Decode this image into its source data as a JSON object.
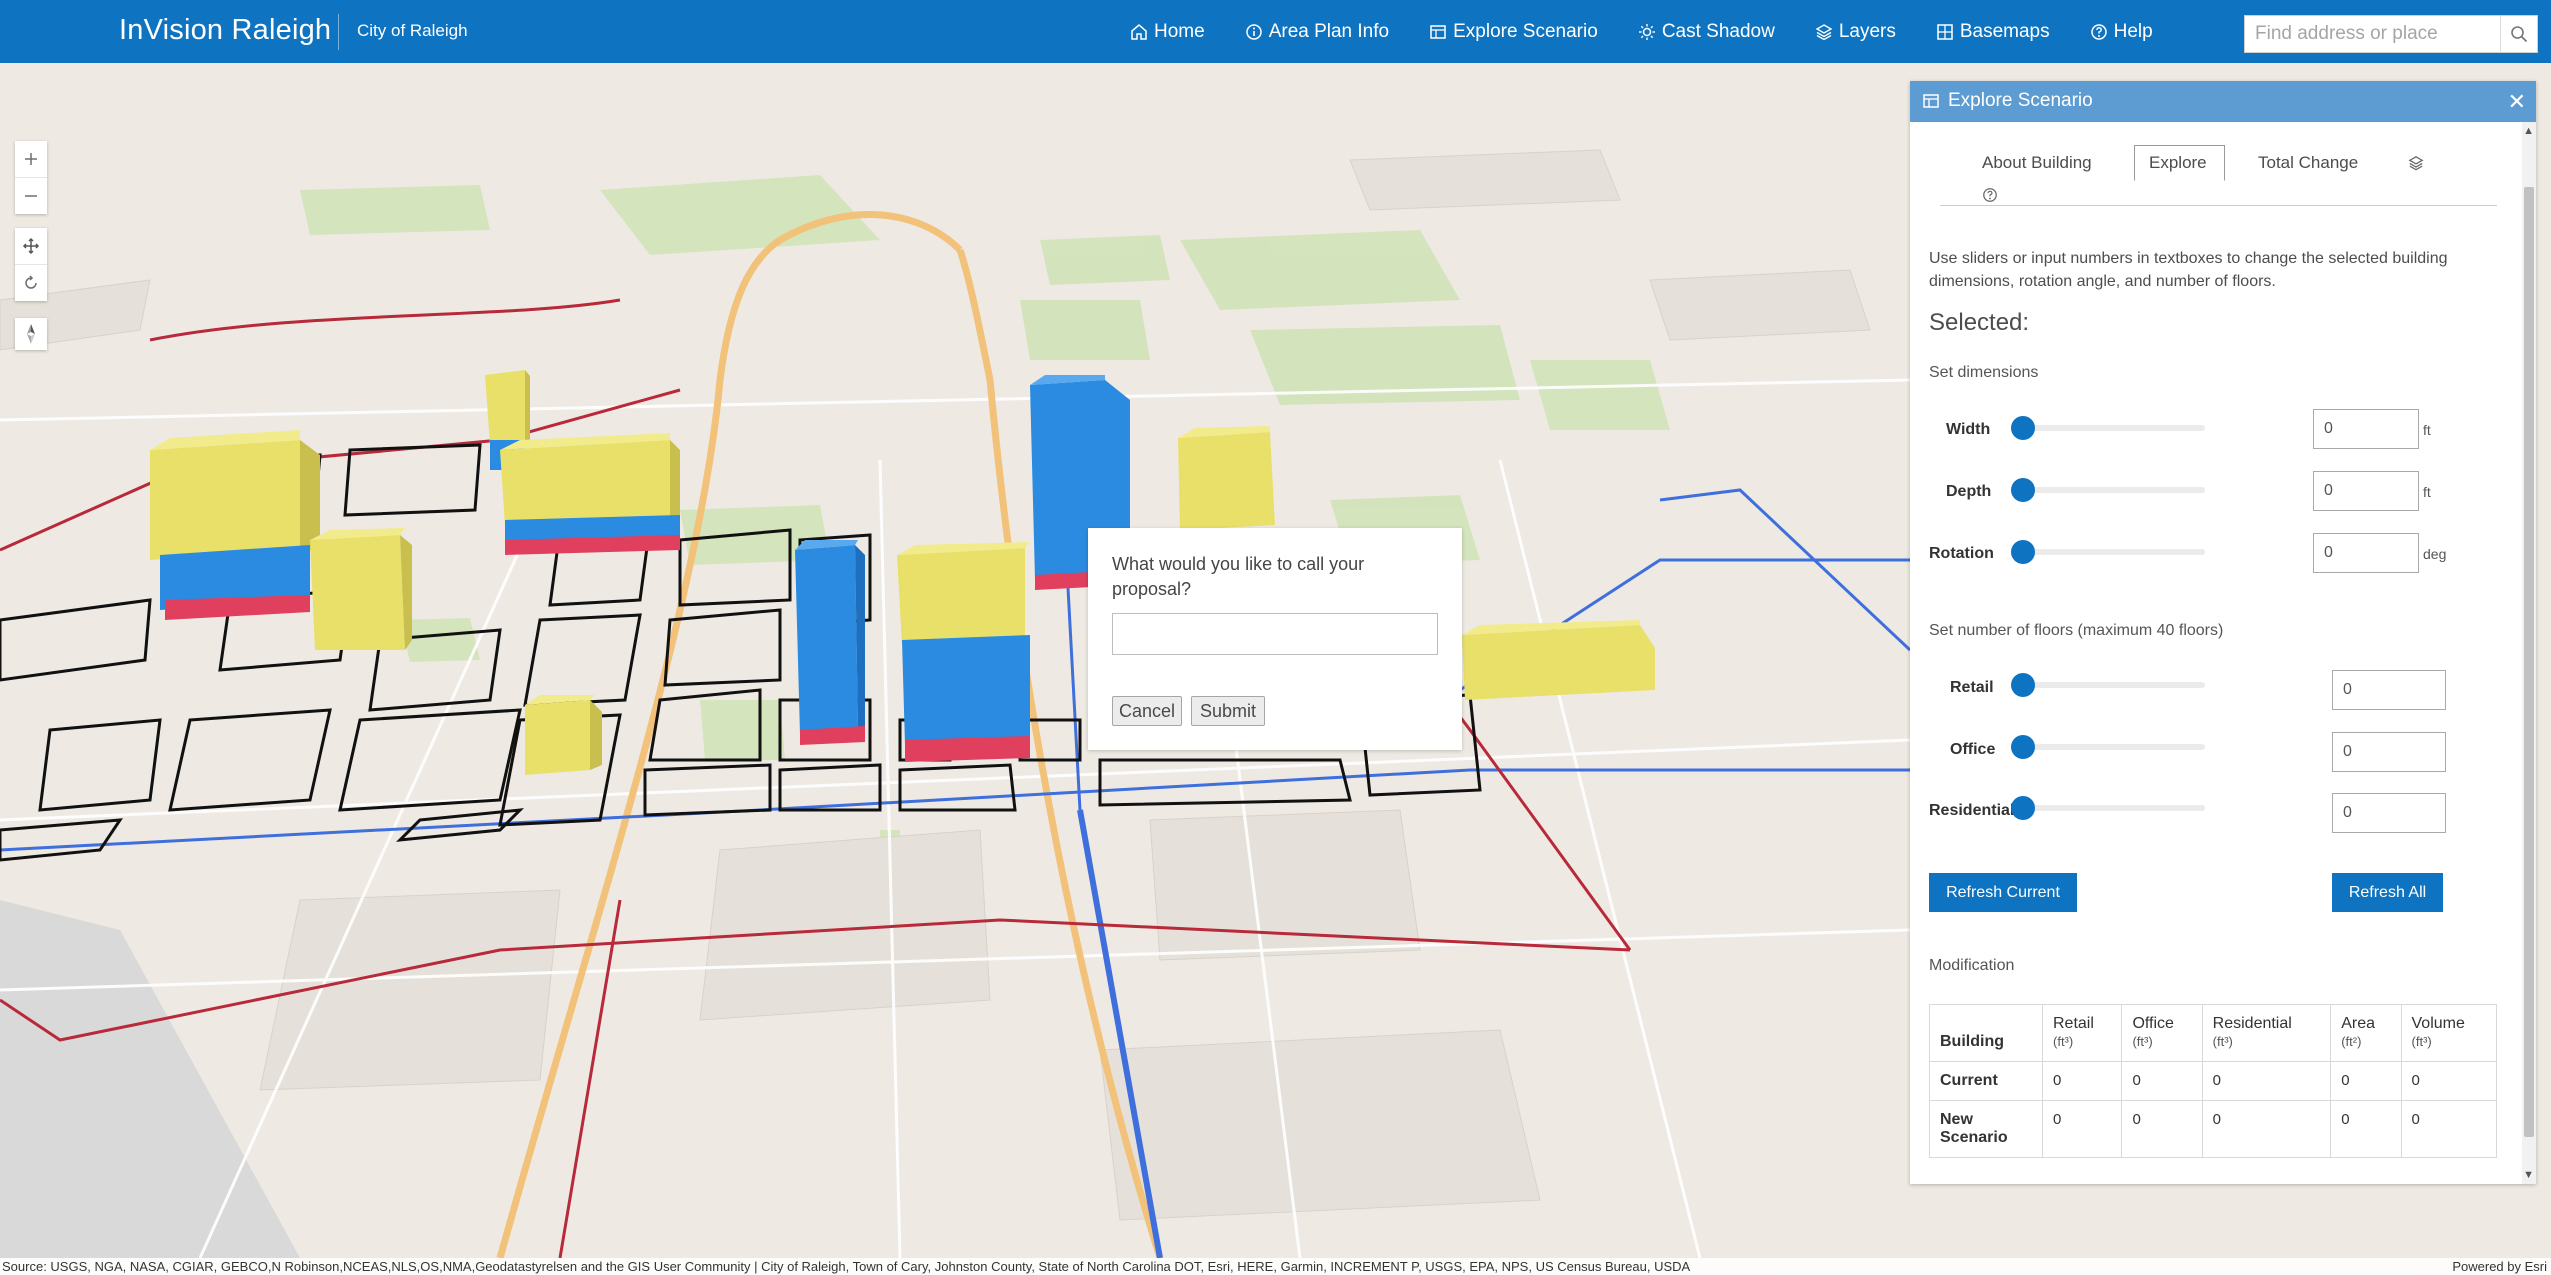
{
  "header": {
    "app_title": "InVision Raleigh",
    "app_subtitle": "City of Raleigh",
    "nav": [
      {
        "label": "Home",
        "icon": "home-icon"
      },
      {
        "label": "Area Plan Info",
        "icon": "info-icon"
      },
      {
        "label": "Explore Scenario",
        "icon": "explore-icon"
      },
      {
        "label": "Cast Shadow",
        "icon": "sun-icon"
      },
      {
        "label": "Layers",
        "icon": "layers-icon"
      },
      {
        "label": "Basemaps",
        "icon": "grid-icon"
      },
      {
        "label": "Help",
        "icon": "help-icon"
      }
    ],
    "search_placeholder": "Find address or place"
  },
  "colors": {
    "header_bg": "#0e73c0",
    "panel_header_bg": "#5c9cd3",
    "building_yellow": "#e9e06a",
    "building_blue": "#2a8be0",
    "building_red": "#e0405e",
    "primary_button": "#0e73c0"
  },
  "dialog": {
    "question": "What would you like to call your proposal?",
    "input_value": "",
    "cancel_label": "Cancel",
    "submit_label": "Submit"
  },
  "panel": {
    "title": "Explore Scenario",
    "close_label": "✕",
    "tabs": [
      "About Building",
      "Explore",
      "Total Change"
    ],
    "active_tab": "Explore",
    "description": "Use sliders or input numbers in textboxes to change the selected building dimensions, rotation angle, and number of floors.",
    "selected_label": "Selected:",
    "dimensions_heading": "Set dimensions",
    "dimensions": [
      {
        "label": "Width",
        "value": "0",
        "unit": "ft"
      },
      {
        "label": "Depth",
        "value": "0",
        "unit": "ft"
      },
      {
        "label": "Rotation",
        "value": "0",
        "unit": "deg"
      }
    ],
    "floors_heading": "Set number of floors (maximum 40 floors)",
    "floors": [
      {
        "label": "Retail",
        "value": "0"
      },
      {
        "label": "Office",
        "value": "0"
      },
      {
        "label": "Residential",
        "value": "0"
      }
    ],
    "refresh_current_label": "Refresh Current",
    "refresh_all_label": "Refresh All",
    "modification_heading": "Modification",
    "table": {
      "headers": [
        {
          "name": "Building",
          "unit": ""
        },
        {
          "name": "Retail",
          "unit": "(ft³)"
        },
        {
          "name": "Office",
          "unit": "(ft³)"
        },
        {
          "name": "Residential",
          "unit": "(ft³)"
        },
        {
          "name": "Area",
          "unit": "(ft²)"
        },
        {
          "name": "Volume",
          "unit": "(ft³)"
        }
      ],
      "rows": [
        {
          "label": "Current",
          "values": [
            "0",
            "0",
            "0",
            "0",
            "0"
          ]
        },
        {
          "label": "New Scenario",
          "values": [
            "0",
            "0",
            "0",
            "0",
            "0"
          ]
        }
      ]
    }
  },
  "attribution": {
    "source": "Source: USGS, NGA, NASA, CGIAR, GEBCO,N Robinson,NCEAS,NLS,OS,NMA,Geodatastyrelsen and the GIS User Community | City of Raleigh, Town of Cary, Johnston County, State of North Carolina DOT, Esri, HERE, Garmin, INCREMENT P, USGS, EPA, NPS, US Census Bureau, USDA",
    "powered_by": "Powered by Esri"
  }
}
